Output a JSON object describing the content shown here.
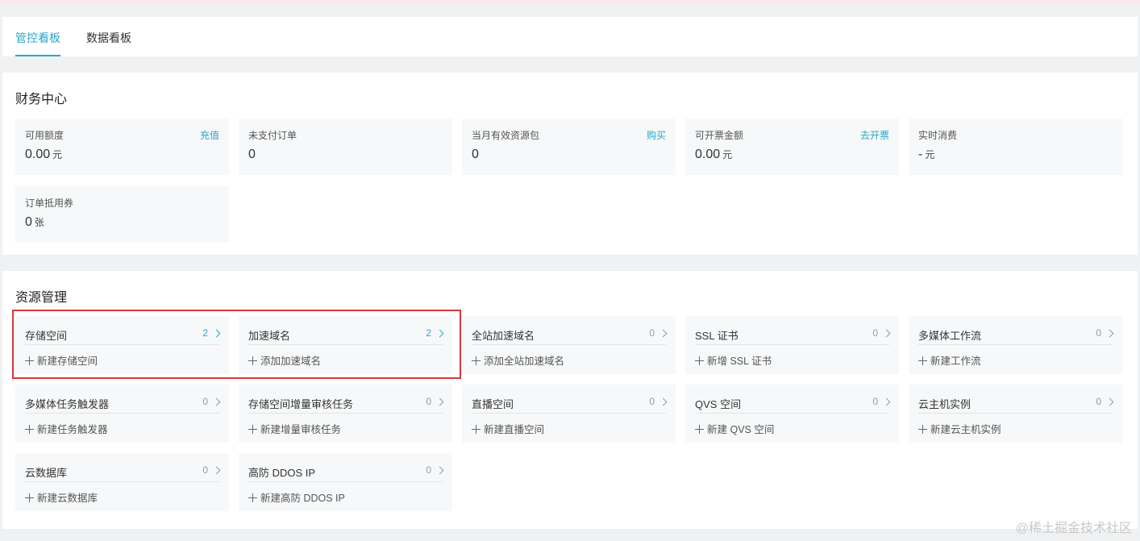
{
  "tabs": [
    {
      "label": "管控看板",
      "active": true
    },
    {
      "label": "数据看板",
      "active": false
    }
  ],
  "finance": {
    "title": "财务中心",
    "tiles": [
      {
        "label": "可用额度",
        "action": "充值",
        "value": "0.00",
        "unit": "元"
      },
      {
        "label": "未支付订单",
        "action": "",
        "value": "0",
        "unit": ""
      },
      {
        "label": "当月有效资源包",
        "action": "购买",
        "value": "0",
        "unit": ""
      },
      {
        "label": "可开票金额",
        "action": "去开票",
        "value": "0.00",
        "unit": "元"
      },
      {
        "label": "实时消费",
        "action": "",
        "value": "-",
        "unit": "元"
      },
      {
        "label": "订单抵用券",
        "action": "",
        "value": "0",
        "unit": "张"
      }
    ]
  },
  "resources": {
    "title": "资源管理",
    "tiles": [
      {
        "name": "存储空间",
        "count": "2",
        "add": "新建存储空间"
      },
      {
        "name": "加速域名",
        "count": "2",
        "add": "添加加速域名"
      },
      {
        "name": "全站加速域名",
        "count": "0",
        "add": "添加全站加速域名"
      },
      {
        "name": "SSL 证书",
        "count": "0",
        "add": "新增 SSL 证书"
      },
      {
        "name": "多媒体工作流",
        "count": "0",
        "add": "新建工作流"
      },
      {
        "name": "多媒体任务触发器",
        "count": "0",
        "add": "新建任务触发器"
      },
      {
        "name": "存储空间增量审核任务",
        "count": "0",
        "add": "新建增量审核任务"
      },
      {
        "name": "直播空间",
        "count": "0",
        "add": "新建直播空间"
      },
      {
        "name": "QVS 空间",
        "count": "0",
        "add": "新建 QVS 空间"
      },
      {
        "name": "云主机实例",
        "count": "0",
        "add": "新建云主机实例"
      },
      {
        "name": "云数据库",
        "count": "0",
        "add": "新建云数据库"
      },
      {
        "name": "高防 DDOS IP",
        "count": "0",
        "add": "新建高防 DDOS IP"
      }
    ]
  },
  "watermark": "@稀土掘金技术社区",
  "colors": {
    "accent": "#2aa7c9",
    "highlight": "#d9363e"
  }
}
